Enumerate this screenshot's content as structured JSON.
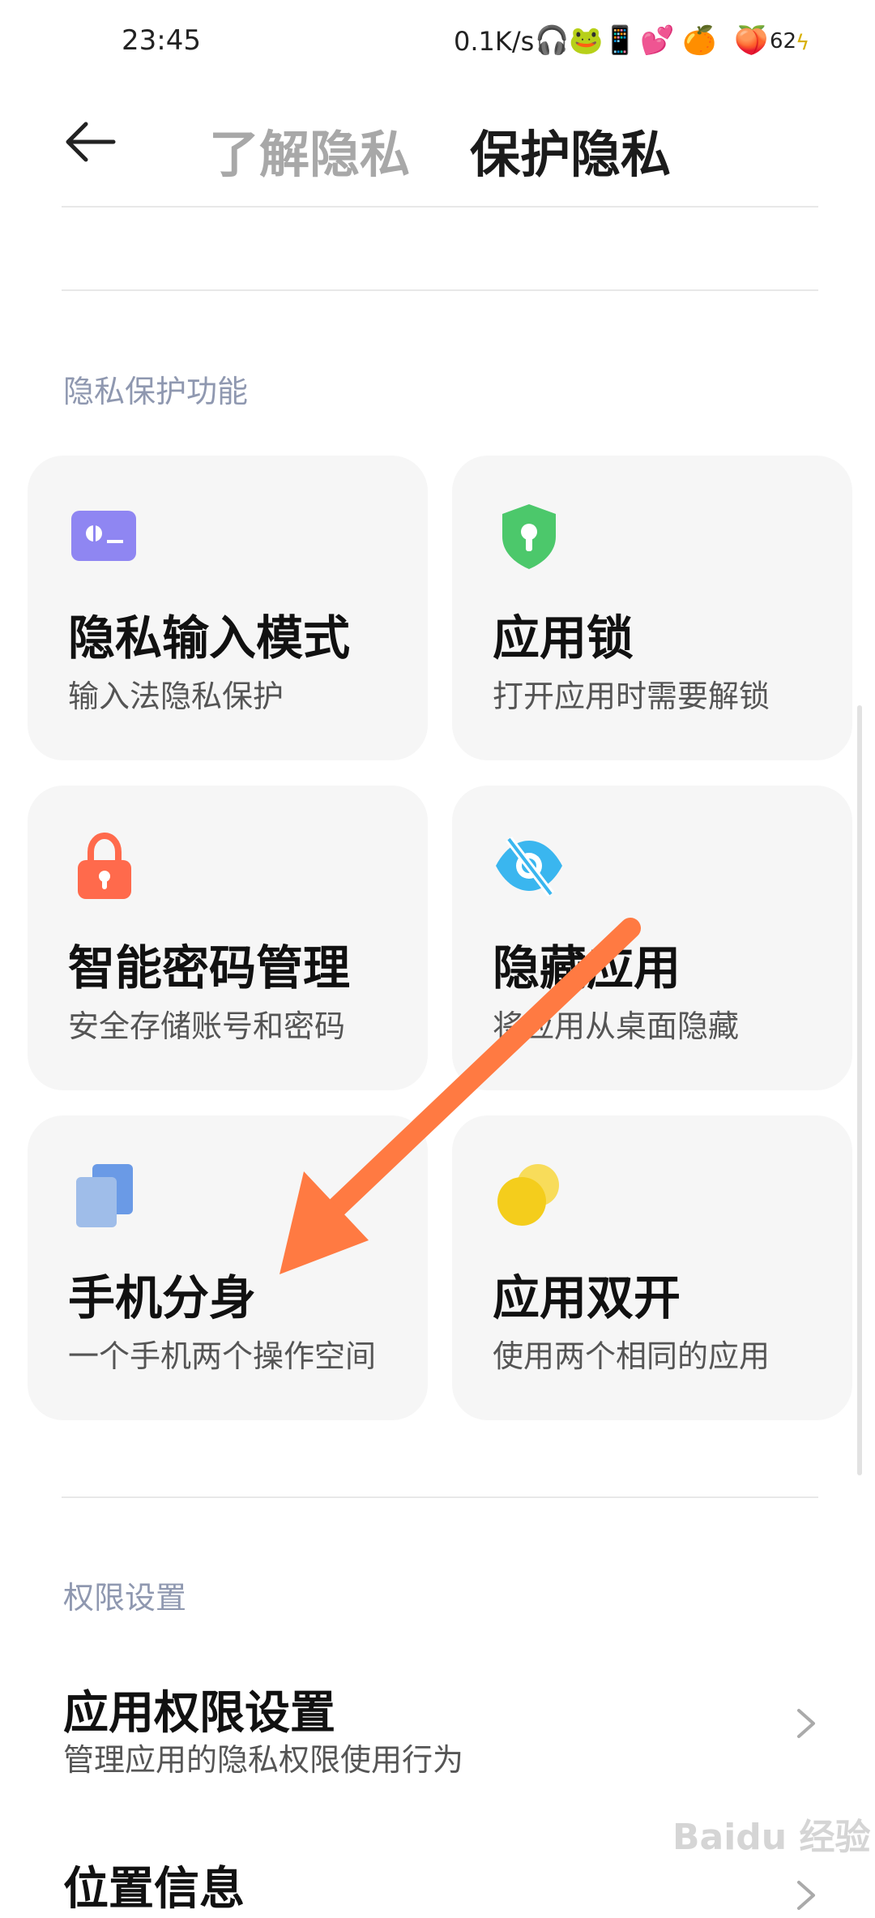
{
  "status_bar": {
    "time": "23:45",
    "net_speed": "0.1K/s",
    "battery": "62"
  },
  "header": {
    "tabs": [
      "了解隐私",
      "保护隐私"
    ],
    "active_tab": 1
  },
  "privacy_section": {
    "label": "隐私保护功能",
    "cards": [
      {
        "title": "隐私输入模式",
        "subtitle": "输入法隐私保护",
        "icon": "keyboard-privacy-icon",
        "color": "#8f86f2"
      },
      {
        "title": "应用锁",
        "subtitle": "打开应用时需要解锁",
        "icon": "shield-lock-icon",
        "color": "#4cc86b"
      },
      {
        "title": "智能密码管理",
        "subtitle": "安全存储账号和密码",
        "icon": "padlock-icon",
        "color": "#ff6a4c"
      },
      {
        "title": "隐藏应用",
        "subtitle": "将应用从桌面隐藏",
        "icon": "eye-hidden-icon",
        "color": "#3ab6ef"
      },
      {
        "title": "手机分身",
        "subtitle": "一个手机两个操作空间",
        "icon": "dual-space-icon",
        "color": "#6a9ae6"
      },
      {
        "title": "应用双开",
        "subtitle": "使用两个相同的应用",
        "icon": "dual-apps-icon",
        "color": "#f4cd1c"
      }
    ]
  },
  "permission_section": {
    "label": "权限设置",
    "items": [
      {
        "title": "应用权限设置",
        "subtitle": "管理应用的隐私权限使用行为"
      },
      {
        "title": "位置信息",
        "subtitle": ""
      }
    ]
  },
  "watermark": "Baidu 经验"
}
